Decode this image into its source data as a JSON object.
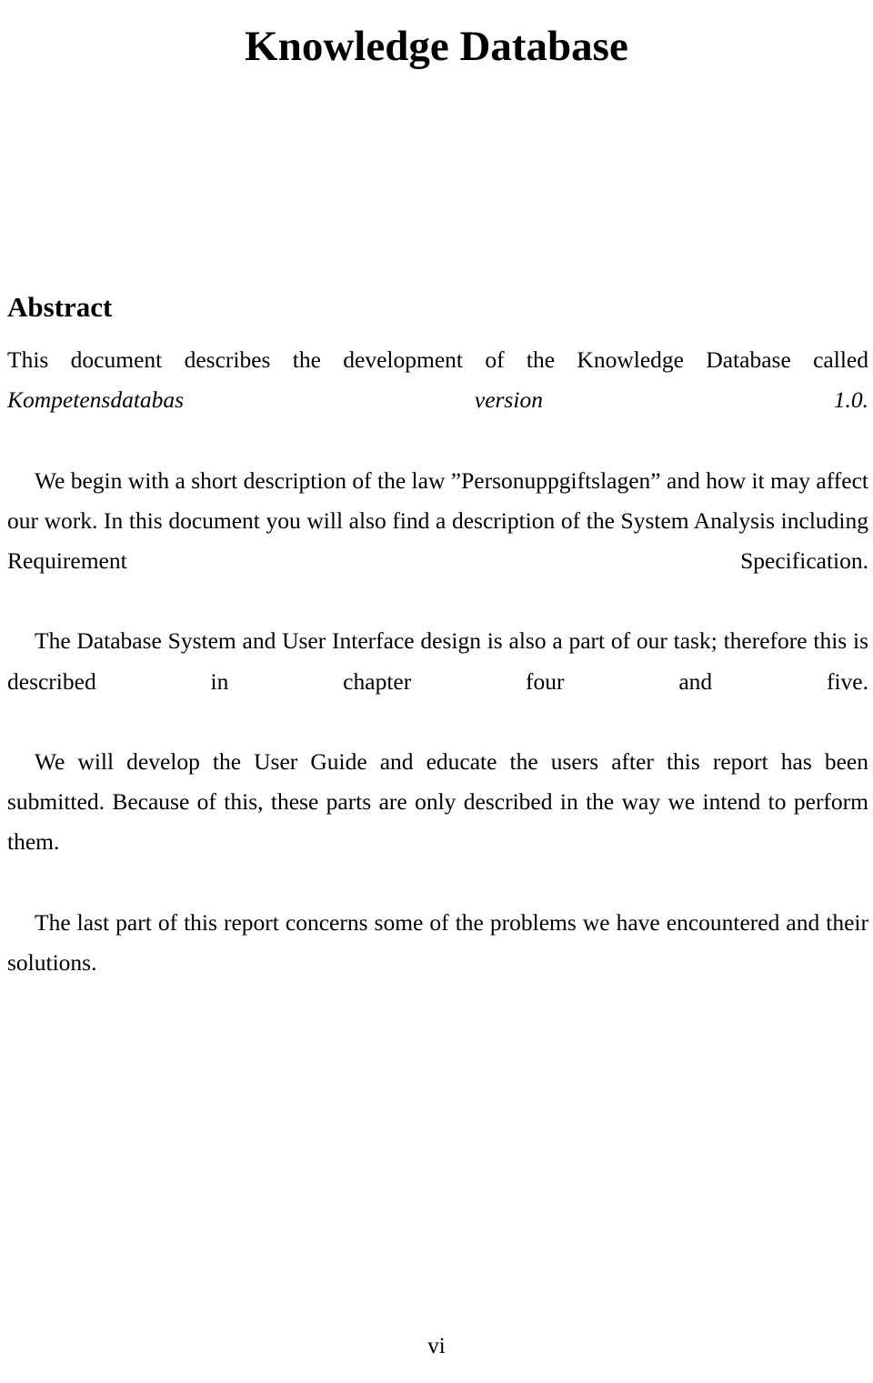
{
  "document": {
    "title": "Knowledge Database",
    "section_heading": "Abstract",
    "page_number": "vi",
    "paragraphs": [
      {
        "id": "abstract-p1",
        "indent": false,
        "text_plain": "This document describes the development of the Knowledge Database called Kompetensdatabas version 1.0.",
        "runs": [
          {
            "style": "normal",
            "text": "This document describes the development of the Knowledge Database called "
          },
          {
            "style": "italic",
            "text": "Kompetensdatabas version 1.0."
          }
        ]
      },
      {
        "id": "abstract-p2",
        "indent": true,
        "text_plain": "We begin with a short description of the law ”Personuppgiftslagen” and how it may affect our work. In this document you will also find a description of the System Analysis including Requirement Specification.",
        "runs": [
          {
            "style": "normal",
            "text": "We begin with a short description of the law ”Personuppgiftslagen” and how it may affect our work. In this document you will also find a description of the System Analysis including Requirement Specification."
          }
        ]
      },
      {
        "id": "abstract-p3",
        "indent": true,
        "text_plain": "The Database System and User Interface design is also a part of our task; therefore this is described in chapter four and five.",
        "runs": [
          {
            "style": "normal",
            "text": "The Database System and User Interface design is also a part of our task; therefore this is described in chapter four and five."
          }
        ]
      },
      {
        "id": "abstract-p4",
        "indent": true,
        "text_plain": "We will develop the User Guide and educate the users after this report has been submitted. Because of this, these parts are only described in the way we intend to perform them.",
        "runs": [
          {
            "style": "normal",
            "text": "We will develop the User Guide and educate the users after this report has been submitted. Because of this, these parts are only described in the way we intend to perform them."
          }
        ]
      },
      {
        "id": "abstract-p5",
        "indent": true,
        "text_plain": "The last part of this report concerns some of the problems we have encountered and their solutions.",
        "runs": [
          {
            "style": "normal",
            "text": "The last part of this report concerns some of the problems we have encountered and their solutions."
          }
        ]
      }
    ]
  },
  "colors": {
    "page_background": "#ffffff",
    "text": "#000000"
  }
}
